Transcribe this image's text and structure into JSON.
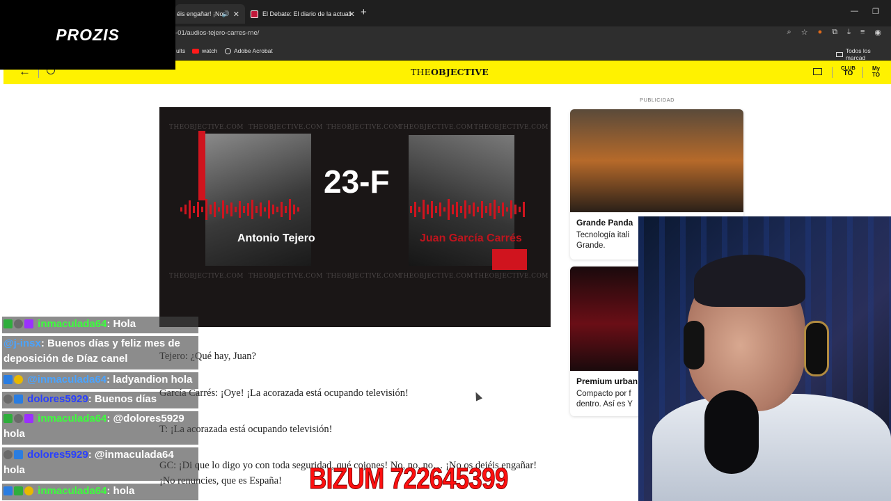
{
  "browser": {
    "tabs": [
      {
        "label": "éis engañar! ¡No",
        "active": true
      },
      {
        "label": "El Debate: El diario de la actuali",
        "active": false
      }
    ],
    "url": "-01/audios-tejero-carres-rne/",
    "bookmarks": [
      "ults",
      "watch",
      "Adobe Acrobat"
    ],
    "bookmarks_folder": "Todos los marcad"
  },
  "overlay_brand": "PROZIS",
  "site": {
    "logo_prefix": "THE",
    "logo_bold": "OBJECTIVE",
    "club_label": [
      "CLUB",
      "TO"
    ],
    "my_label": [
      "My",
      "TO"
    ]
  },
  "hero": {
    "title": "23-F",
    "name_left": "Antonio Tejero",
    "name_right": "Juan García Carrés",
    "watermark": "THEOBJECTIVE.COM"
  },
  "article": {
    "paragraphs": [
      "Tejero: ¿Qué hay, Juan?",
      "García Carrés: ¡Oye! ¡La acorazada está ocupando televisión!",
      "T: ¡La acorazada está ocupando televisión!",
      "GC: ¡Di que lo digo yo con toda seguridad, qué cojones! No, no, no… ¡No os dejéis engañar!",
      "¡No renuncies, que es España!"
    ]
  },
  "ads": {
    "label": "PUBLICIDAD",
    "cards": [
      {
        "title": "Grande Panda",
        "desc_lines": [
          "Tecnología itali",
          "Grande."
        ]
      },
      {
        "title": "Premium urban",
        "desc_lines": [
          "Compacto por f",
          "dentro. Así es Y"
        ]
      }
    ]
  },
  "chat": [
    {
      "user": "inmaculada64",
      "user_color": "#3cff3c",
      "badges": [
        "green",
        "gray",
        "purple"
      ],
      "text": ": Hola"
    },
    {
      "user": "@j-insx",
      "user_color": "#4aa3ff",
      "badges": [],
      "text": ": Buenos días y feliz mes de deposición de Díaz canel"
    },
    {
      "user": "@inmaculada64",
      "user_color": "#4aa3ff",
      "badges": [
        "blue",
        "yellow"
      ],
      "text": ": ladyandion hola"
    },
    {
      "user": "dolores5929",
      "user_color": "#2940ff",
      "badges": [
        "gray",
        "blue"
      ],
      "text": ": Buenos días"
    },
    {
      "user": "inmaculada64",
      "user_color": "#3cff3c",
      "badges": [
        "green",
        "gray",
        "purple"
      ],
      "text": ": @dolores5929 hola"
    },
    {
      "user": "dolores5929",
      "user_color": "#2940ff",
      "badges": [
        "gray",
        "blue"
      ],
      "text": ": @inmaculada64 hola"
    },
    {
      "user": "inmaculada64",
      "user_color": "#3cff3c",
      "badges": [
        "blue",
        "green",
        "yellow"
      ],
      "text": ": hola"
    }
  ],
  "banner": "BIZUM 722645399"
}
